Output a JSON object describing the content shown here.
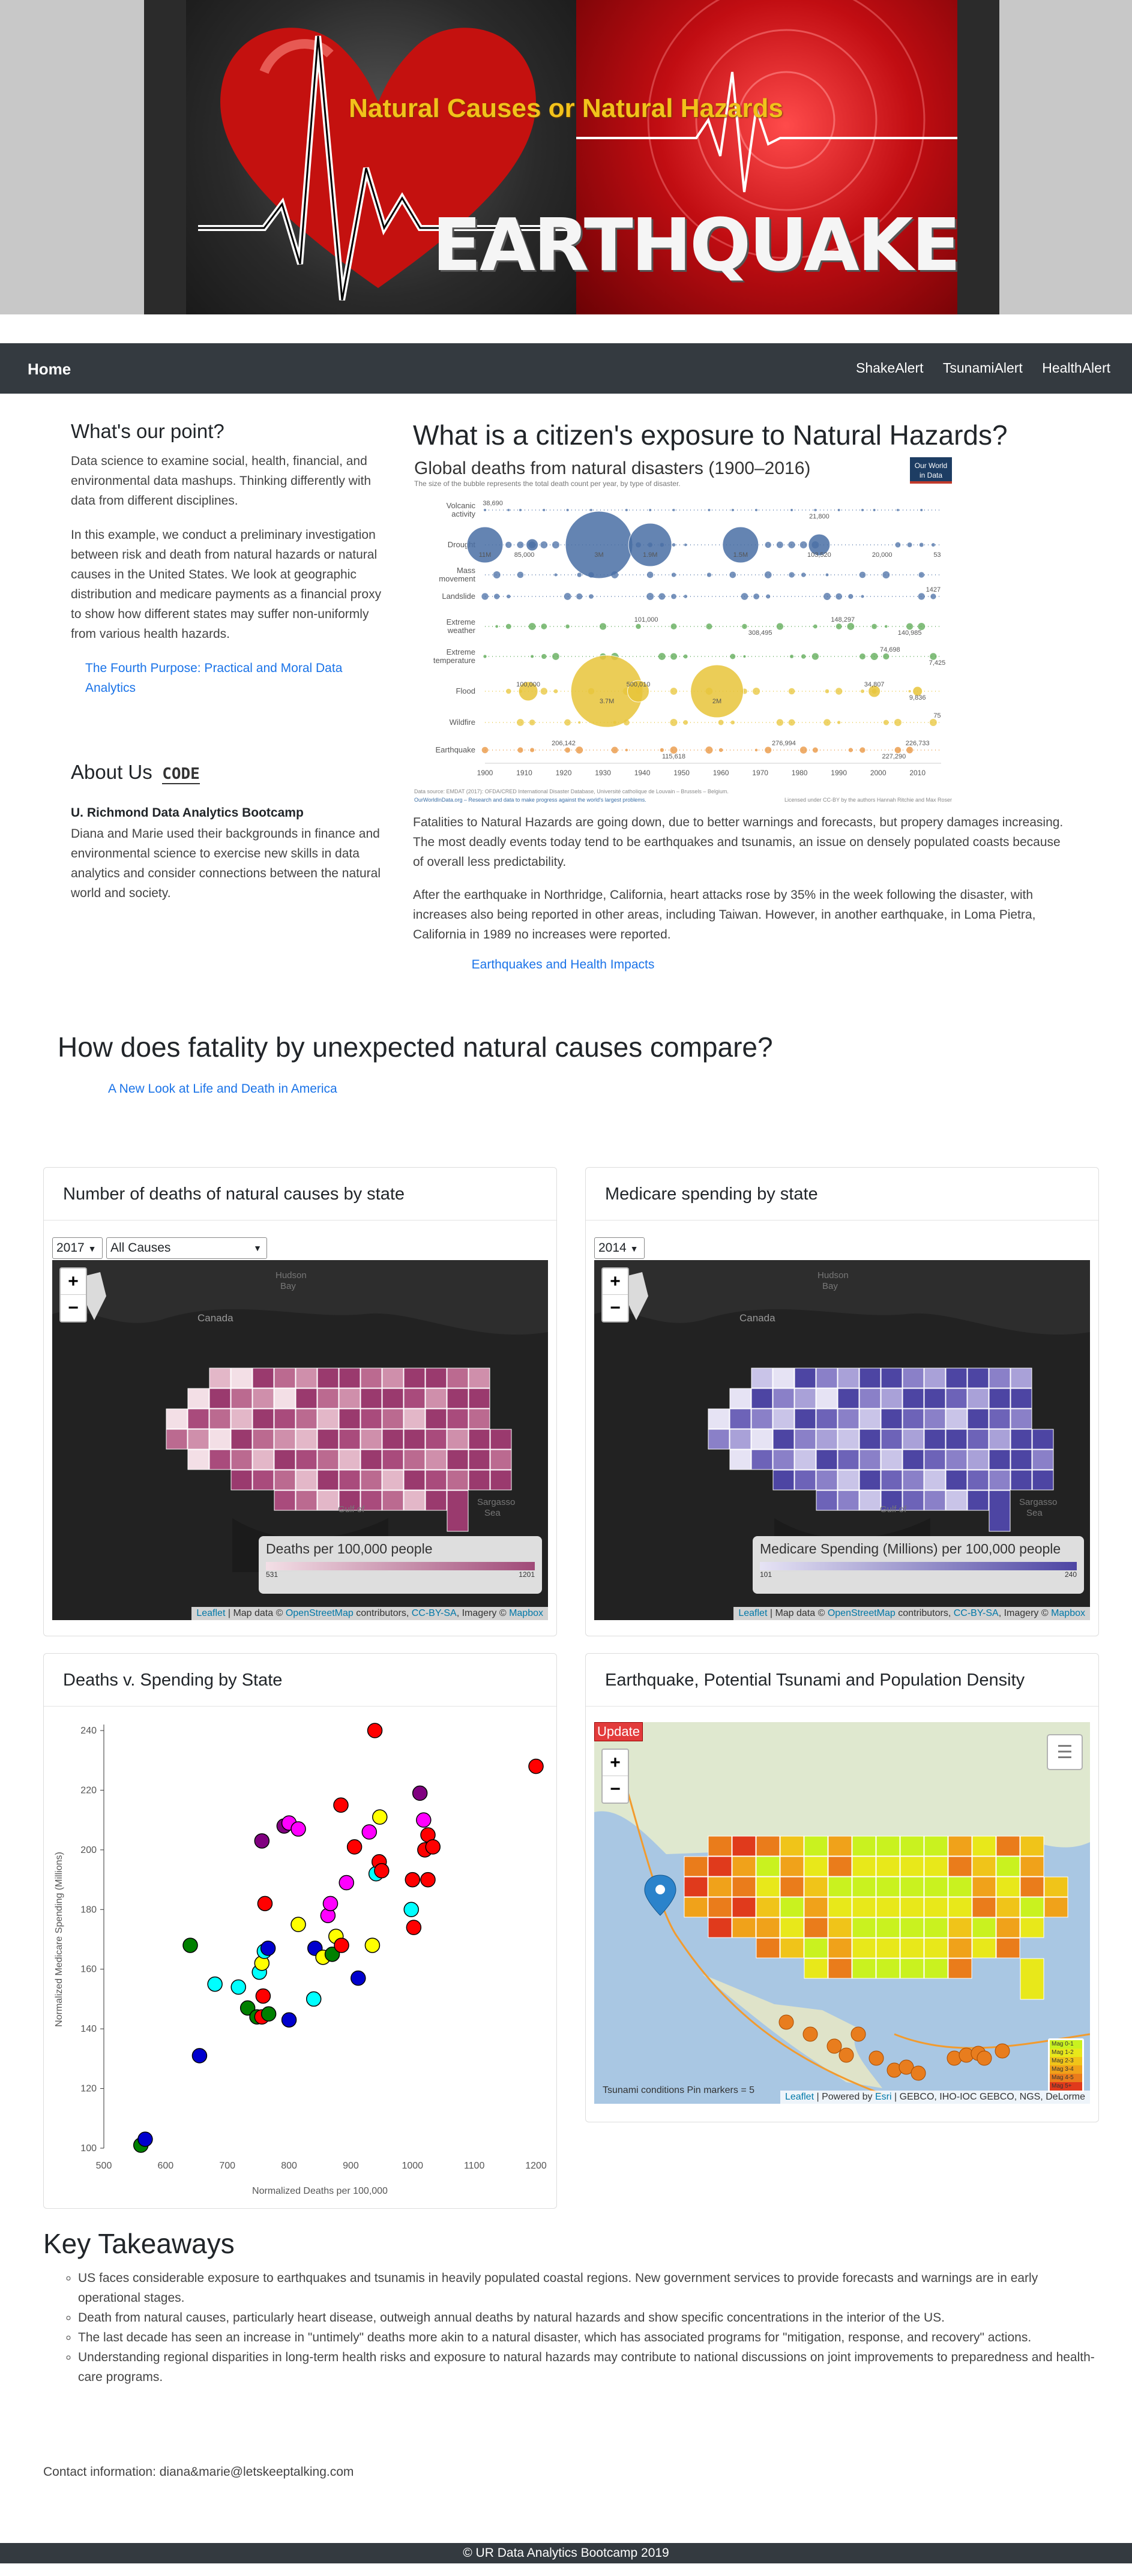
{
  "hero": {
    "title": "Natural Causes or Natural Hazards",
    "banner_text": "EARTHQUAKE"
  },
  "nav": {
    "home": "Home",
    "links": [
      "ShakeAlert",
      "TsunamiAlert",
      "HealthAlert"
    ]
  },
  "intro": {
    "heading": "What's our point?",
    "p1": "Data science to examine social, health, financial, and environmental data mashups. Thinking differently with data from different disciplines.",
    "p2": "In this example, we conduct a preliminary investigation between risk and death from natural hazards or natural causes in the United States. We look at geographic distribution and medicare payments as a financial proxy to show how different states may suffer non-uniformly from various health hazards.",
    "link": "The Fourth Purpose: Practical and Moral Data Analytics"
  },
  "about": {
    "heading": "About Us",
    "logo_text": "CODE",
    "subheading": "U. Richmond Data Analytics Bootcamp",
    "text": "Diana and Marie used their backgrounds in finance and environmental science to exercise new skills in data analytics and consider connections between the natural world and society."
  },
  "main": {
    "heading": "What is a citizen's exposure to Natural Hazards?",
    "p1": "Fatalities to Natural Hazards are going down, due to better warnings and forecasts, but propery damages increasing. The most deadly events today tend to be earthquakes and tsunamis, an issue on densely populated coasts because of overall less predictability.",
    "p2": "After the earthquake in Northridge, California, heart attacks rose by 35% in the week following the disaster, with increases also being reported in other areas, including Taiwan. However, in another earthquake, in Loma Pietra, California in 1989 no increases were reported.",
    "link": "Earthquakes and Health Impacts"
  },
  "disaster_chart": {
    "title": "Global deaths from natural disasters (1900–2016)",
    "subtitle": "The size of the bubble represents the total death count per year, by type of disaster.",
    "badge": "Our World in Data",
    "source": "Data source: EMDAT (2017): OFDA/CRED International Disaster Database, Université catholique de Louvain – Brussels – Belgium.",
    "credit": "OurWorldInData.org – Research and data to make progress against the world's largest problems.",
    "license": "Licensed under CC-BY by the authors Hannah Ritchie and Max Roser",
    "rows": [
      {
        "name": "Volcanic activity",
        "color": "#4a6fa5",
        "labels": [
          {
            "year": 1902,
            "text": "38,690"
          },
          {
            "year": 1985,
            "text": "21,800"
          }
        ]
      },
      {
        "name": "Drought",
        "color": "#4a6fa5",
        "labels": [
          {
            "year": 1900,
            "text": "11M"
          },
          {
            "year": 1910,
            "text": "85,000"
          },
          {
            "year": 1929,
            "text": "3M"
          },
          {
            "year": 1942,
            "text": "1.9M"
          },
          {
            "year": 1965,
            "text": "1.5M"
          },
          {
            "year": 1985,
            "text": "103,520"
          },
          {
            "year": 2001,
            "text": "20,000"
          },
          {
            "year": 2015,
            "text": "53"
          }
        ]
      },
      {
        "name": "Mass movement",
        "color": "#4a6fa5",
        "labels": []
      },
      {
        "name": "Landslide",
        "color": "#4a6fa5",
        "labels": [
          {
            "year": 2014,
            "text": "1427"
          }
        ]
      },
      {
        "name": "Extreme weather",
        "color": "#5aa852",
        "labels": [
          {
            "year": 1941,
            "text": "101,000"
          },
          {
            "year": 1970,
            "text": "308,495"
          },
          {
            "year": 1991,
            "text": "148,297"
          },
          {
            "year": 2008,
            "text": "140,985"
          }
        ]
      },
      {
        "name": "Extreme temperature",
        "color": "#5aa852",
        "labels": [
          {
            "year": 2003,
            "text": "74,698"
          },
          {
            "year": 2015,
            "text": "7,425"
          }
        ]
      },
      {
        "name": "Flood",
        "color": "#e8c53a",
        "labels": [
          {
            "year": 1911,
            "text": "100,000"
          },
          {
            "year": 1931,
            "text": "3.7M"
          },
          {
            "year": 1939,
            "text": "500,010"
          },
          {
            "year": 1959,
            "text": "2M"
          },
          {
            "year": 1999,
            "text": "34,807"
          },
          {
            "year": 2010,
            "text": "9,836"
          }
        ]
      },
      {
        "name": "Wildfire",
        "color": "#e8c53a",
        "labels": [
          {
            "year": 2015,
            "text": "75"
          }
        ]
      },
      {
        "name": "Earthquake",
        "color": "#e8923a",
        "labels": [
          {
            "year": 1920,
            "text": "206,142"
          },
          {
            "year": 1948,
            "text": "115,618"
          },
          {
            "year": 1976,
            "text": "276,994"
          },
          {
            "year": 2004,
            "text": "227,290"
          },
          {
            "year": 2010,
            "text": "226,733"
          }
        ]
      }
    ],
    "years": [
      "1900",
      "1910",
      "1920",
      "1930",
      "1940",
      "1950",
      "1960",
      "1970",
      "1980",
      "1990",
      "2000",
      "2010"
    ]
  },
  "section2": {
    "heading": "How does fatality by unexpected natural causes compare?",
    "link": "A New Look at Life and Death in America"
  },
  "card_deaths": {
    "title": "Number of deaths of natural causes by state",
    "year": "2017",
    "cause": "All Causes",
    "legend_title": "Deaths per 100,000 people",
    "legend_min": "531",
    "legend_max": "1201",
    "labels": {
      "hudson": "Hudson Bay",
      "canada": "Canada",
      "gulf": "Gulf of Mexico",
      "sargasso": "Sargasso Sea"
    }
  },
  "card_medicare": {
    "title": "Medicare spending by state",
    "year": "2014",
    "legend_title": "Medicare Spending (Millions) per 100,000 people",
    "legend_min": "101",
    "legend_max": "240",
    "labels": {
      "hudson": "Hudson Bay",
      "canada": "Canada",
      "gulf": "Gulf of Mexico",
      "sargasso": "Sargasso Sea"
    }
  },
  "attribution": {
    "leaflet": "Leaflet",
    "mapdata": " | Map data © ",
    "osm": "OpenStreetMap",
    "contrib": " contributors, ",
    "ccbysa": "CC-BY-SA",
    "imagery": ", Imagery © ",
    "mapbox": "Mapbox"
  },
  "card_scatter": {
    "title": "Deaths v. Spending by State",
    "xlabel": "Normalized Deaths per 100,000",
    "ylabel": "Normalized Medicare Spending (Millions)"
  },
  "card_quake": {
    "title": "Earthquake, Potential Tsunami and Population Density",
    "update": "Update",
    "legend_label": "Tsunami conditions Pin markers = 5",
    "attr_leaflet": "Leaflet",
    "attr_powered": " | Powered by ",
    "attr_esri": "Esri",
    "attr_rest": " | GEBCO, IHO-IOC GEBCO, NGS, DeLorme",
    "mag_legend": [
      {
        "label": "Mag 0-1",
        "color": "#c9f21f"
      },
      {
        "label": "Mag 1-2",
        "color": "#e8e81a"
      },
      {
        "label": "Mag 2-3",
        "color": "#f0c419"
      },
      {
        "label": "Mag 3-4",
        "color": "#f0a21a"
      },
      {
        "label": "Mag 4-5",
        "color": "#ea7c1b"
      },
      {
        "label": "Mag 5+",
        "color": "#e03a1c"
      }
    ]
  },
  "chart_data": {
    "type": "scatter",
    "xlabel": "Normalized Deaths per 100,000",
    "ylabel": "Normalized Medicare Spending (Millions)",
    "xlim": [
      500,
      1200
    ],
    "ylim": [
      100,
      240
    ],
    "xticks": [
      500,
      600,
      700,
      800,
      900,
      1000,
      1100,
      1200
    ],
    "yticks": [
      100,
      120,
      140,
      160,
      180,
      200,
      220,
      240
    ],
    "points": [
      {
        "x": 560,
        "y": 101,
        "color": "#008000"
      },
      {
        "x": 567,
        "y": 103,
        "color": "#0000cd"
      },
      {
        "x": 640,
        "y": 168,
        "color": "#008000"
      },
      {
        "x": 655,
        "y": 131,
        "color": "#0000cd"
      },
      {
        "x": 680,
        "y": 155,
        "color": "#00ffff"
      },
      {
        "x": 718,
        "y": 154,
        "color": "#00ffff"
      },
      {
        "x": 733,
        "y": 147,
        "color": "#008000"
      },
      {
        "x": 748,
        "y": 144,
        "color": "#008000"
      },
      {
        "x": 752,
        "y": 159,
        "color": "#00ffff"
      },
      {
        "x": 756,
        "y": 162,
        "color": "#ffff00"
      },
      {
        "x": 760,
        "y": 166,
        "color": "#00ffff"
      },
      {
        "x": 766,
        "y": 167,
        "color": "#0000cd"
      },
      {
        "x": 758,
        "y": 151,
        "color": "#ff0000"
      },
      {
        "x": 756,
        "y": 144,
        "color": "#ff0000"
      },
      {
        "x": 767,
        "y": 145,
        "color": "#008000"
      },
      {
        "x": 761,
        "y": 182,
        "color": "#ff0000"
      },
      {
        "x": 756,
        "y": 203,
        "color": "#800080"
      },
      {
        "x": 800,
        "y": 143,
        "color": "#0000cd"
      },
      {
        "x": 792,
        "y": 208,
        "color": "#800080"
      },
      {
        "x": 800,
        "y": 209,
        "color": "#ff00ff"
      },
      {
        "x": 815,
        "y": 207,
        "color": "#ff00ff"
      },
      {
        "x": 815,
        "y": 175,
        "color": "#ffff00"
      },
      {
        "x": 840,
        "y": 150,
        "color": "#00ffff"
      },
      {
        "x": 842,
        "y": 167,
        "color": "#0000cd"
      },
      {
        "x": 855,
        "y": 164,
        "color": "#ffff00"
      },
      {
        "x": 863,
        "y": 178,
        "color": "#ff00ff"
      },
      {
        "x": 867,
        "y": 182,
        "color": "#ff00ff"
      },
      {
        "x": 870,
        "y": 165,
        "color": "#008000"
      },
      {
        "x": 876,
        "y": 171,
        "color": "#ffff00"
      },
      {
        "x": 884,
        "y": 215,
        "color": "#ff0000"
      },
      {
        "x": 885,
        "y": 168,
        "color": "#ff0000"
      },
      {
        "x": 893,
        "y": 189,
        "color": "#ff00ff"
      },
      {
        "x": 906,
        "y": 201,
        "color": "#ff0000"
      },
      {
        "x": 912,
        "y": 157,
        "color": "#0000cd"
      },
      {
        "x": 930,
        "y": 206,
        "color": "#ff00ff"
      },
      {
        "x": 935,
        "y": 168,
        "color": "#ffff00"
      },
      {
        "x": 939,
        "y": 240,
        "color": "#ff0000"
      },
      {
        "x": 941,
        "y": 192,
        "color": "#00ffff"
      },
      {
        "x": 946,
        "y": 196,
        "color": "#ff0000"
      },
      {
        "x": 950,
        "y": 193,
        "color": "#ff0000"
      },
      {
        "x": 947,
        "y": 211,
        "color": "#ffff00"
      },
      {
        "x": 1000,
        "y": 190,
        "color": "#ff0000"
      },
      {
        "x": 1002,
        "y": 174,
        "color": "#ff0000"
      },
      {
        "x": 998,
        "y": 180,
        "color": "#00ffff"
      },
      {
        "x": 1012,
        "y": 219,
        "color": "#800080"
      },
      {
        "x": 1018,
        "y": 210,
        "color": "#ff00ff"
      },
      {
        "x": 1020,
        "y": 200,
        "color": "#ff0000"
      },
      {
        "x": 1025,
        "y": 205,
        "color": "#ff0000"
      },
      {
        "x": 1025,
        "y": 190,
        "color": "#ff0000"
      },
      {
        "x": 1033,
        "y": 201,
        "color": "#ff0000"
      },
      {
        "x": 1200,
        "y": 228,
        "color": "#ff0000"
      }
    ]
  },
  "takeaways": {
    "heading": "Key Takeaways",
    "items": [
      "US faces considerable exposure to earthquakes and tsunamis in heavily populated coastal regions. New government services to provide forecasts and warnings are in early operational stages.",
      "Death from natural causes, particularly heart disease, outweigh annual deaths by natural hazards and show specific concentrations in the interior of the US.",
      "The last decade has seen an increase in \"untimely\" deaths more akin to a natural disaster, which has associated programs for \"mitigation, response, and recovery\" actions.",
      "Understanding regional disparities in long-term health risks and exposure to natural hazards may contribute to national discussions on joint improvements to preparedness and health-care programs."
    ]
  },
  "contact": "Contact information: diana&marie@letskeeptalking.com",
  "footer": "© UR Data Analytics Bootcamp 2019"
}
